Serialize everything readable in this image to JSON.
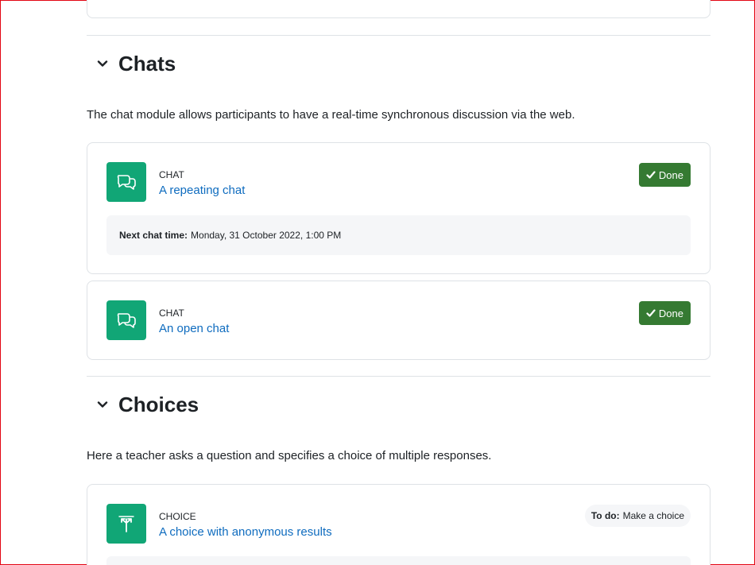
{
  "sections": [
    {
      "title": "Chats",
      "summary": "The chat module allows participants to have a real-time synchronous discussion via the web.",
      "activities": [
        {
          "type": "Chat",
          "name": "A repeating chat",
          "status": "Done",
          "info_label": "Next chat time:",
          "info_value": "Monday, 31 October 2022, 1:00 PM"
        },
        {
          "type": "Chat",
          "name": "An open chat",
          "status": "Done"
        }
      ]
    },
    {
      "title": "Choices",
      "summary": "Here a teacher asks a question and specifies a choice of multiple responses.",
      "activities": [
        {
          "type": "Choice",
          "name": "A choice with anonymous results",
          "todo_label": "To do:",
          "todo_value": "Make a choice"
        }
      ]
    }
  ],
  "colors": {
    "activity_icon_bg": "#11a676",
    "done_bg": "#357a32",
    "link": "#0f6cbf",
    "info_bg": "#f5f6f8",
    "border": "#dee2e6"
  },
  "icons": {
    "chevron": "chevron-down-icon",
    "chat": "chat-bubbles-icon",
    "choice": "signpost-icon",
    "done": "check-icon"
  }
}
